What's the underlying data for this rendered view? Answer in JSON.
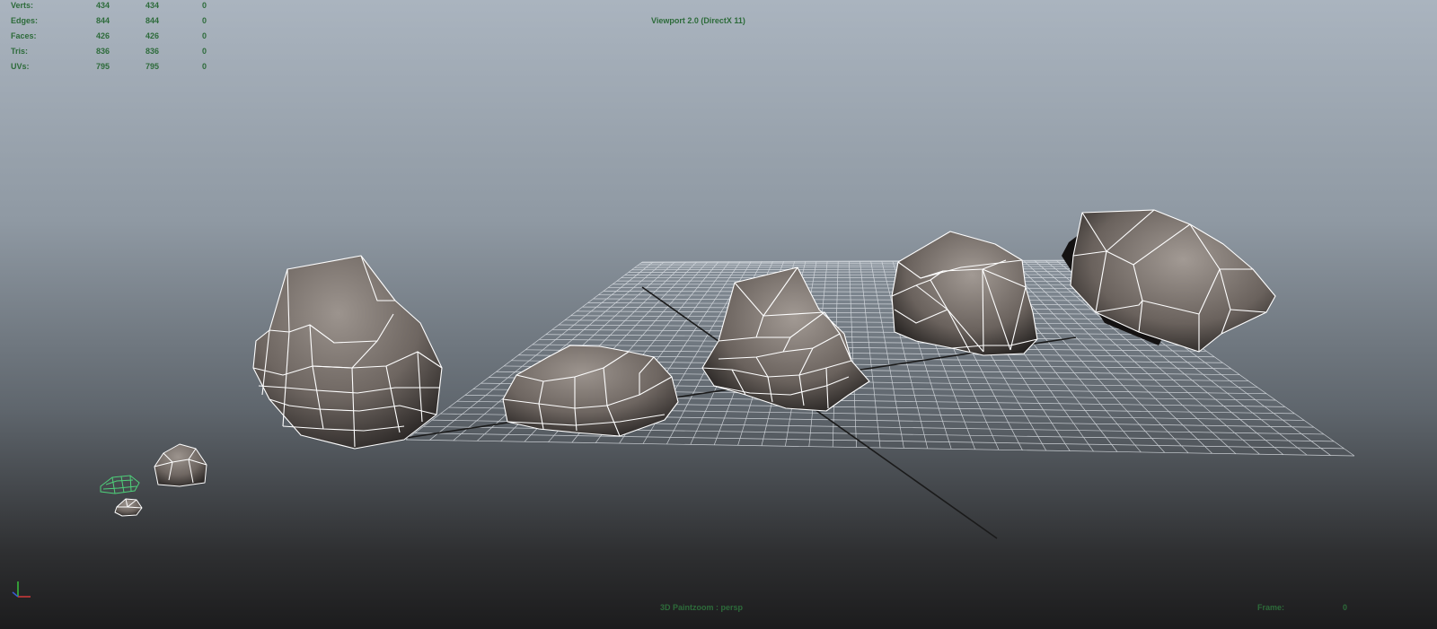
{
  "viewport": {
    "title": "Viewport 2.0 (DirectX 11)",
    "camera_label": "3D Paintzoom : persp",
    "frame_label": "Frame:",
    "frame_value": "0"
  },
  "hud": {
    "rows": [
      {
        "label": "Verts:",
        "v1": "434",
        "v2": "434",
        "v3": "0"
      },
      {
        "label": "Edges:",
        "v1": "844",
        "v2": "844",
        "v3": "0"
      },
      {
        "label": "Faces:",
        "v1": "426",
        "v2": "426",
        "v3": "0"
      },
      {
        "label": "Tris:",
        "v1": "836",
        "v2": "836",
        "v3": "0"
      },
      {
        "label": "UVs:",
        "v1": "795",
        "v2": "795",
        "v3": "0"
      }
    ]
  },
  "colors": {
    "hud_text": "#2d6b3a",
    "wire": "#ffffff",
    "selected_wire": "#4ed07a",
    "grid": "#dfe3e8",
    "axis_x": "#d23a3a",
    "axis_y": "#39c03c",
    "axis_z": "#3a5ad2"
  },
  "icons": {
    "axis_gizmo": "axis-gizmo-icon"
  }
}
